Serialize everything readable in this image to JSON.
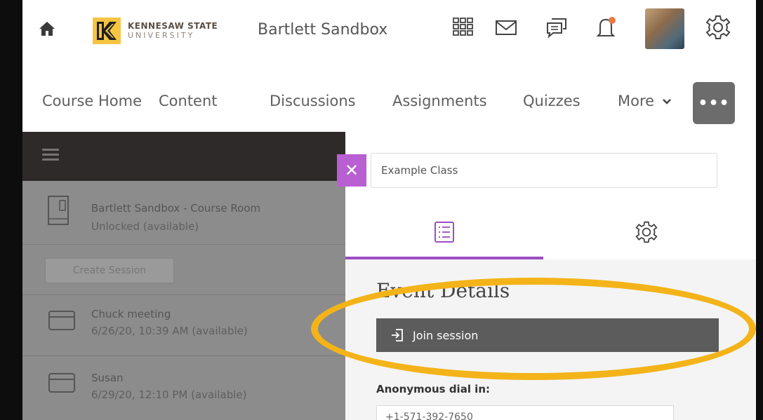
{
  "header": {
    "logo_line1": "KENNESAW STATE",
    "logo_line2": "UNIVERSITY",
    "org_name": "Bartlett Sandbox"
  },
  "icons": [
    "home-icon",
    "apps-grid-icon",
    "mail-icon",
    "chat-icon",
    "bell-icon",
    "gear-icon"
  ],
  "colors": {
    "accent": "#9b4ec3",
    "highlight": "#f3b319",
    "alert": "#e8794a"
  },
  "course_nav": {
    "items": [
      "Course Home",
      "Content",
      "Discussions",
      "Assignments",
      "Quizzes",
      "More"
    ],
    "more_menu": "•••"
  },
  "left_panel": {
    "room": {
      "title": "Bartlett Sandbox - Course Room",
      "status": "Unlocked (available)"
    },
    "create_session": "Create Session",
    "sessions": [
      {
        "title": "Chuck meeting",
        "status": "6/26/20, 10:39 AM (available)"
      },
      {
        "title": "Susan",
        "status": "6/29/20, 12:10 PM (available)"
      }
    ]
  },
  "right_panel": {
    "class_name": "Example Class",
    "section_title": "Event Details",
    "join_label": "Join session",
    "anon_label": "Anonymous dial in:",
    "phone": "+1-571-392-7650"
  }
}
